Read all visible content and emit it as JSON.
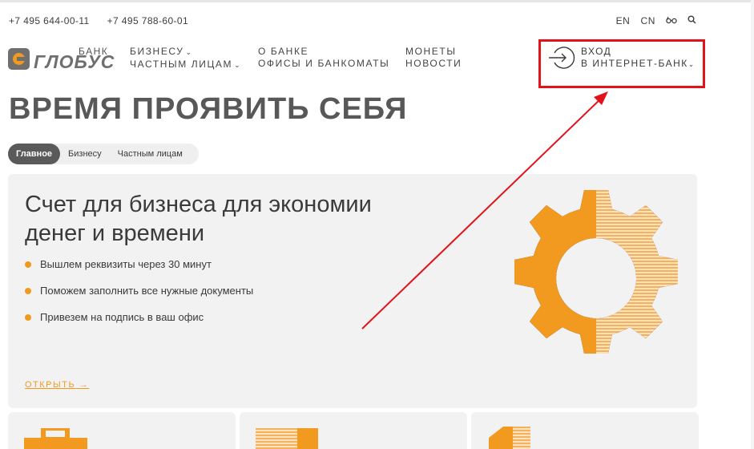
{
  "header": {
    "phones": [
      "+7 495 644-00-11",
      "+7 495 788-60-01"
    ],
    "languages": [
      "EN",
      "CN"
    ],
    "accessibility_icon": "glasses-icon",
    "search_icon": "search-icon"
  },
  "logo": {
    "bank_label": "БАНК",
    "name": "ГЛОБУС"
  },
  "nav": {
    "col1": [
      "БИЗНЕСУ",
      "ЧАСТНЫМ ЛИЦАМ"
    ],
    "col2": [
      "О БАНКЕ",
      "ОФИСЫ И БАНКОМАТЫ"
    ],
    "col3": [
      "МОНЕТЫ",
      "НОВОСТИ"
    ]
  },
  "login": {
    "line1": "ВХОД",
    "line2": "В ИНТЕРНЕТ-БАНК",
    "icon": "login-arrow-icon"
  },
  "hero": {
    "title": "ВРЕМЯ ПРОЯВИТЬ СЕБЯ"
  },
  "tabs": [
    {
      "label": "Главное",
      "active": true
    },
    {
      "label": "Бизнесу",
      "active": false
    },
    {
      "label": "Частным лицам",
      "active": false
    }
  ],
  "promo": {
    "title": "Счет для бизнеса для экономии денег и времени",
    "bullets": [
      "Вышлем реквизиты через 30 минут",
      "Поможем заполнить все нужные документы",
      "Привезем на подпись в ваш офис"
    ],
    "link": "ОТКРЫТЬ →",
    "image": "gear-icon"
  },
  "colors": {
    "accent": "#f29a1f",
    "text": "#3a3a3a",
    "highlight_box": "#e0141a",
    "card_bg": "#f2f2f2"
  }
}
